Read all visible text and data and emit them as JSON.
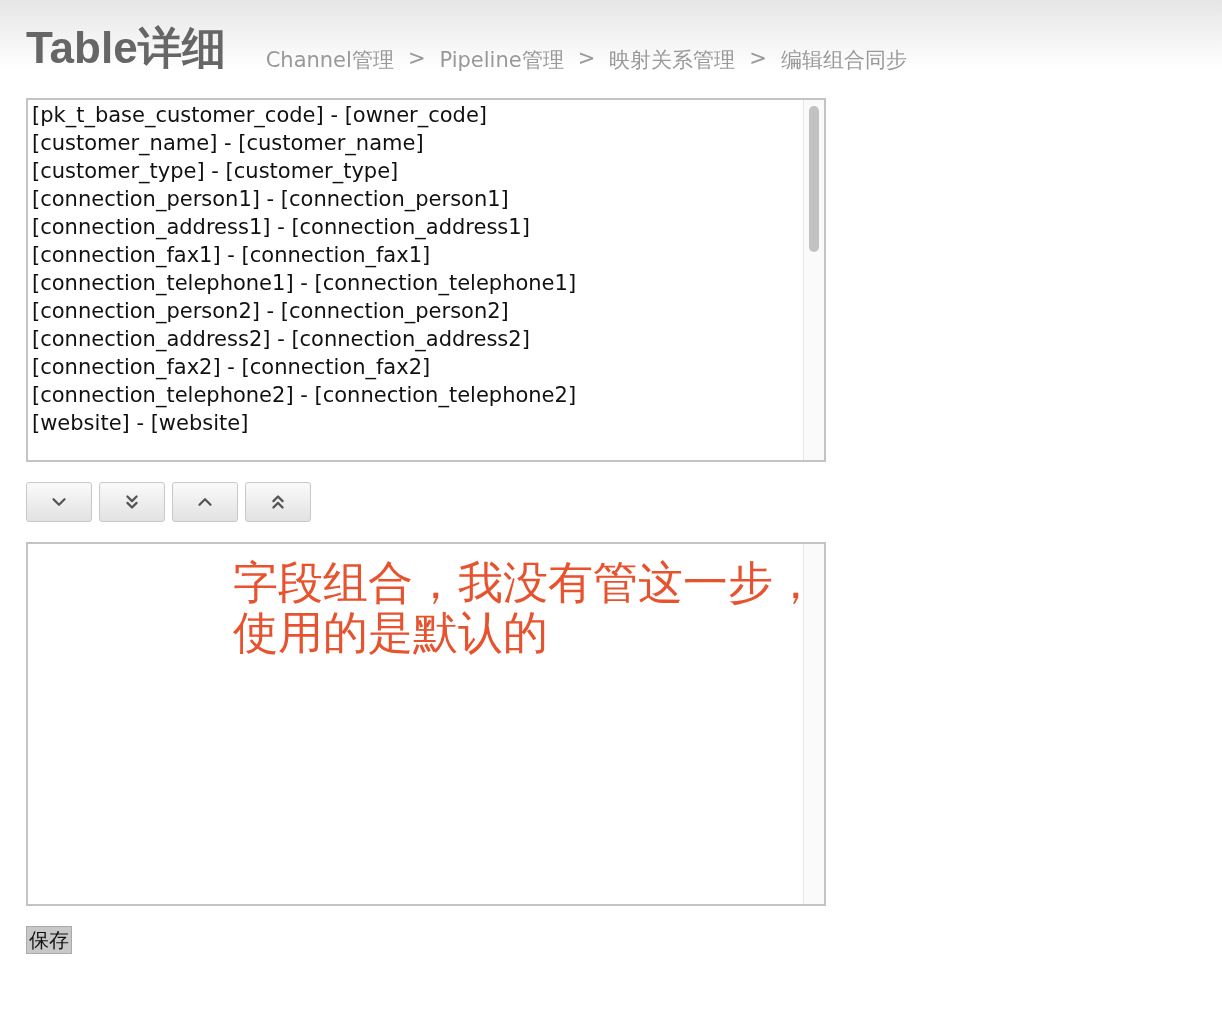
{
  "header": {
    "title": "Table详细",
    "breadcrumb": [
      {
        "label": "Channel管理"
      },
      {
        "label": "Pipeline管理"
      },
      {
        "label": "映射关系管理"
      },
      {
        "label": "编辑组合同步"
      }
    ],
    "separators": [
      ">",
      ">",
      ">"
    ]
  },
  "source_list": {
    "items": [
      "[pk_t_base_customer_code] - [owner_code]",
      "[customer_name] - [customer_name]",
      "[customer_type] - [customer_type]",
      "[connection_person1] - [connection_person1]",
      "[connection_address1] - [connection_address1]",
      "[connection_fax1] - [connection_fax1]",
      "[connection_telephone1] - [connection_telephone1]",
      "[connection_person2] - [connection_person2]",
      "[connection_address2] - [connection_address2]",
      "[connection_fax2] - [connection_fax2]",
      "[connection_telephone2] - [connection_telephone2]",
      "[website] - [website]"
    ]
  },
  "move_buttons": [
    {
      "kind": "down"
    },
    {
      "kind": "bottom"
    },
    {
      "kind": "up"
    },
    {
      "kind": "top"
    }
  ],
  "annotation": {
    "lines": [
      "字段组合，我没有管这一步，",
      "使用的是默认的"
    ]
  },
  "save_button": {
    "label": "保存"
  }
}
